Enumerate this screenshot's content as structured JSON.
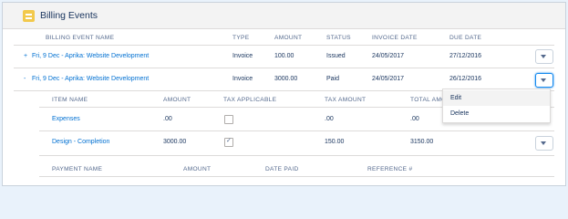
{
  "header": {
    "title": "Billing Events"
  },
  "columns": {
    "name": "BILLING EVENT NAME",
    "type": "TYPE",
    "amount": "AMOUNT",
    "status": "STATUS",
    "invoice_date": "INVOICE DATE",
    "due_date": "DUE DATE"
  },
  "events": [
    {
      "toggle": "+",
      "name": "Fri, 9 Dec - Aprika: Website Development",
      "type": "Invoice",
      "amount": "100.00",
      "status": "Issued",
      "invoice_date": "24/05/2017",
      "due_date": "27/12/2016"
    },
    {
      "toggle": "-",
      "name": "Fri, 9 Dec - Aprika: Website Development",
      "type": "Invoice",
      "amount": "3000.00",
      "status": "Paid",
      "invoice_date": "24/05/2017",
      "due_date": "26/12/2016"
    }
  ],
  "item_columns": {
    "name": "ITEM NAME",
    "amount": "AMOUNT",
    "tax_applicable": "TAX APPLICABLE",
    "tax_amount": "TAX AMOUNT",
    "total_amount": "TOTAL AMO"
  },
  "items": [
    {
      "name": "Expenses",
      "amount": ".00",
      "tax_applicable": false,
      "tax_amount": ".00",
      "total": ".00"
    },
    {
      "name": "Design - Completion",
      "amount": "3000.00",
      "tax_applicable": true,
      "tax_amount": "150.00",
      "total": "3150.00"
    }
  ],
  "payment_columns": {
    "name": "PAYMENT NAME",
    "amount": "AMOUNT",
    "date_paid": "DATE PAID",
    "reference": "REFERENCE #"
  },
  "row_menu": {
    "items": [
      "Edit",
      "Delete"
    ]
  },
  "colors": {
    "link": "#0070d2",
    "header_icon": "#f2c94c",
    "text": "#16325c",
    "subtle": "#54698d"
  }
}
